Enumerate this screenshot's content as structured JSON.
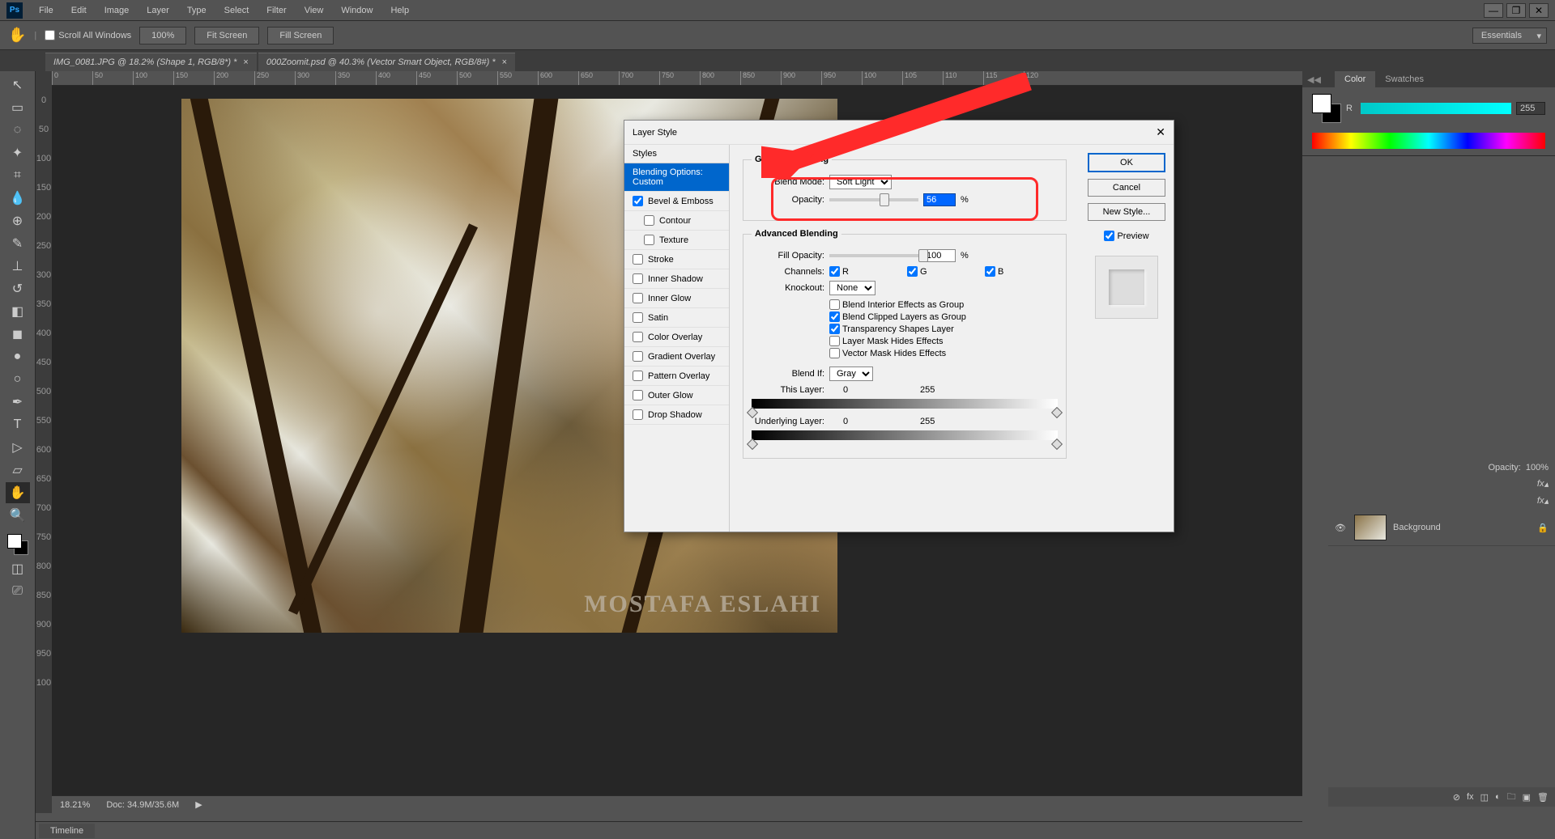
{
  "app": {
    "logo": "Ps"
  },
  "menu": [
    "File",
    "Edit",
    "Image",
    "Layer",
    "Type",
    "Select",
    "Filter",
    "View",
    "Window",
    "Help"
  ],
  "options": {
    "scroll_all": "Scroll All Windows",
    "zoom_100": "100%",
    "fit": "Fit Screen",
    "fill": "Fill Screen",
    "workspace": "Essentials"
  },
  "tabs": [
    {
      "label": "IMG_0081.JPG @ 18.2% (Shape 1, RGB/8*) *"
    },
    {
      "label": "000Zoomit.psd @ 40.3% (Vector Smart Object, RGB/8#) *"
    }
  ],
  "ruler_marks": [
    "0",
    "50",
    "100",
    "150",
    "200",
    "250",
    "300",
    "350",
    "400",
    "450",
    "500",
    "550",
    "600",
    "650",
    "700",
    "750",
    "800",
    "850",
    "900",
    "950",
    "100",
    "105",
    "110",
    "115",
    "120"
  ],
  "tool_numbers": [
    "0",
    "50",
    "100",
    "150",
    "200",
    "250",
    "300",
    "350",
    "400",
    "450",
    "500",
    "550",
    "600",
    "650",
    "700",
    "750",
    "800",
    "850",
    "900",
    "950",
    "100"
  ],
  "status": {
    "zoom": "18.21%",
    "doc": "Doc: 34.9M/35.6M"
  },
  "watermark": "MOSTAFA ESLAHI",
  "color_panel": {
    "tabs": [
      "Color",
      "Swatches"
    ],
    "channel": "R",
    "value": "255"
  },
  "layers": {
    "background": "Background",
    "opacity_label": "Opacity:",
    "opacity_val": "100%",
    "fx": "fx"
  },
  "timeline": "Timeline",
  "dialog": {
    "title": "Layer Style",
    "left": {
      "styles": "Styles",
      "blending_opts": "Blending Options: Custom",
      "items": [
        {
          "label": "Bevel & Emboss",
          "checked": true
        },
        {
          "label": "Contour",
          "checked": false,
          "indent": true
        },
        {
          "label": "Texture",
          "checked": false,
          "indent": true
        },
        {
          "label": "Stroke",
          "checked": false
        },
        {
          "label": "Inner Shadow",
          "checked": false
        },
        {
          "label": "Inner Glow",
          "checked": false
        },
        {
          "label": "Satin",
          "checked": false
        },
        {
          "label": "Color Overlay",
          "checked": false
        },
        {
          "label": "Gradient Overlay",
          "checked": false
        },
        {
          "label": "Pattern Overlay",
          "checked": false
        },
        {
          "label": "Outer Glow",
          "checked": false
        },
        {
          "label": "Drop Shadow",
          "checked": false
        }
      ]
    },
    "general": {
      "legend": "General Blending",
      "blend_mode_label": "Blend Mode:",
      "blend_mode": "Soft Light",
      "opacity_label": "Opacity:",
      "opacity_val": "56",
      "pct": "%"
    },
    "advanced": {
      "legend": "Advanced Blending",
      "fill_opacity_label": "Fill Opacity:",
      "fill_opacity_val": "100",
      "channels_label": "Channels:",
      "ch_r": "R",
      "ch_g": "G",
      "ch_b": "B",
      "knockout_label": "Knockout:",
      "knockout": "None",
      "opts": [
        {
          "label": "Blend Interior Effects as Group",
          "checked": false
        },
        {
          "label": "Blend Clipped Layers as Group",
          "checked": true
        },
        {
          "label": "Transparency Shapes Layer",
          "checked": true
        },
        {
          "label": "Layer Mask Hides Effects",
          "checked": false
        },
        {
          "label": "Vector Mask Hides Effects",
          "checked": false
        }
      ],
      "blend_if_label": "Blend If:",
      "blend_if": "Gray",
      "this_layer": "This Layer:",
      "this_lo": "0",
      "this_hi": "255",
      "under_layer": "Underlying Layer:",
      "under_lo": "0",
      "under_hi": "255"
    },
    "right": {
      "ok": "OK",
      "cancel": "Cancel",
      "new_style": "New Style...",
      "preview": "Preview"
    },
    "partial_legend": "Blending Options"
  }
}
